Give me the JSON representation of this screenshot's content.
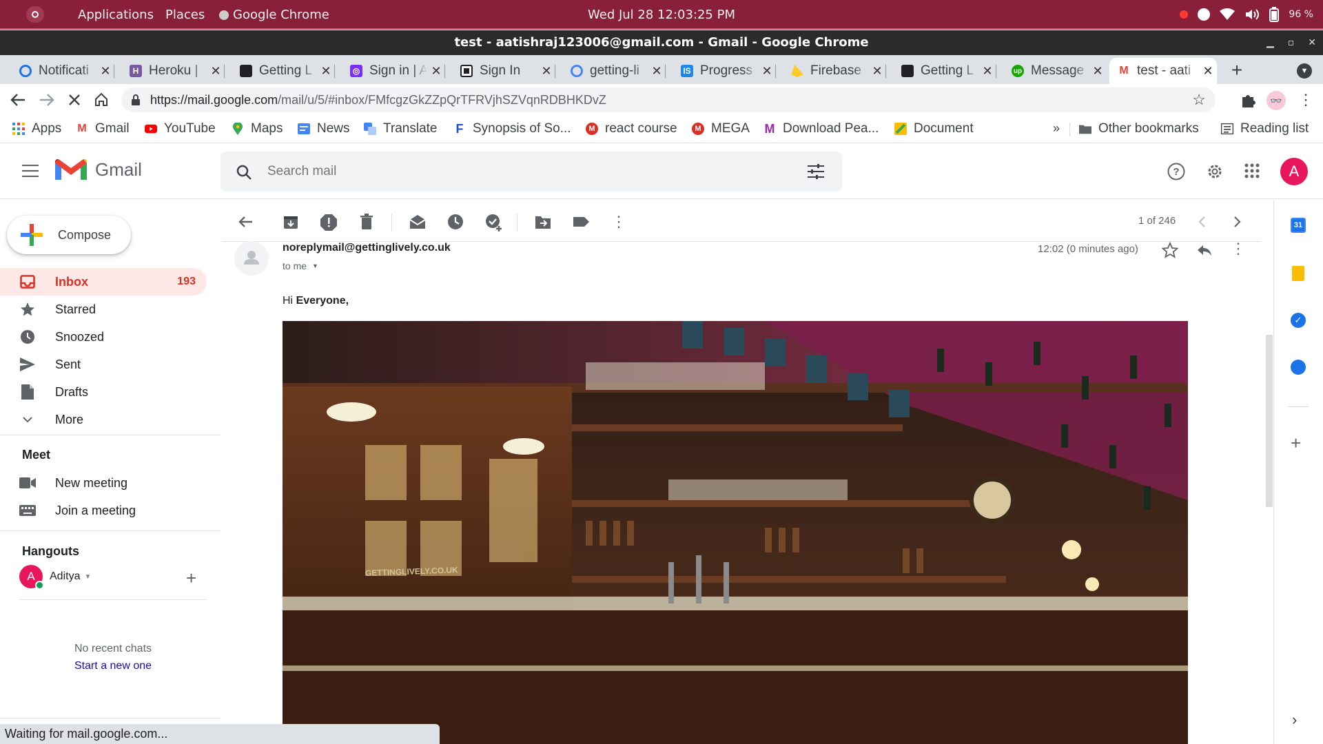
{
  "topbar": {
    "applications": "Applications",
    "places": "Places",
    "app": "Google Chrome",
    "clock": "Wed Jul 28  12:03:25 PM",
    "battery": "96 %"
  },
  "window": {
    "title": "test - aatishraj123006@gmail.com - Gmail - Google Chrome"
  },
  "tabs": [
    {
      "title": "Notificati",
      "color": "#1a73e8"
    },
    {
      "title": "Heroku | ",
      "color": "#79589f"
    },
    {
      "title": "Getting L",
      "color": "#202124"
    },
    {
      "title": "Sign in | A",
      "color": "#7b2ff7"
    },
    {
      "title": "Sign In",
      "color": "#202124"
    },
    {
      "title": "getting-li",
      "color": "#4285f4"
    },
    {
      "title": "Progress",
      "color": "#1e88e5"
    },
    {
      "title": "Firebase ",
      "color": "#ffca28"
    },
    {
      "title": "Getting L",
      "color": "#202124"
    },
    {
      "title": "Message",
      "color": "#14a800"
    },
    {
      "title": "test - aati",
      "color": "#ea4335"
    }
  ],
  "address": {
    "url_host": "https://mail.google.com",
    "url_path": "/mail/u/5/#inbox/FMfcgzGkZZpQrTFRVjhSZVqnRDBHKDvZ"
  },
  "bookmarks": [
    {
      "label": "Apps",
      "color": "#4285f4"
    },
    {
      "label": "Gmail",
      "color": "#ea4335"
    },
    {
      "label": "YouTube",
      "color": "#ff0000"
    },
    {
      "label": "Maps",
      "color": "#34a853"
    },
    {
      "label": "News",
      "color": "#4285f4"
    },
    {
      "label": "Translate",
      "color": "#4285f4"
    },
    {
      "label": "Synopsis of So...",
      "color": "#1a4fd6"
    },
    {
      "label": "react course",
      "color": "#d93025"
    },
    {
      "label": "MEGA",
      "color": "#d93025"
    },
    {
      "label": "Download Pea...",
      "color": "#9c27b0"
    },
    {
      "label": "Document",
      "color": "#fbbc04"
    }
  ],
  "bookmarks_right": {
    "other": "Other bookmarks",
    "reading": "Reading list"
  },
  "gmail": {
    "brand": "Gmail",
    "search_placeholder": "Search mail",
    "avatar_letter": "A"
  },
  "sidebar": {
    "compose": "Compose",
    "nav": [
      {
        "label": "Inbox",
        "count": "193"
      },
      {
        "label": "Starred"
      },
      {
        "label": "Snoozed"
      },
      {
        "label": "Sent"
      },
      {
        "label": "Drafts"
      },
      {
        "label": "More"
      }
    ],
    "meet_heading": "Meet",
    "meet": [
      "New meeting",
      "Join a meeting"
    ],
    "hangouts_heading": "Hangouts",
    "hangouts_user": "Aditya",
    "no_chats": "No recent chats",
    "start_new": "Start a new one"
  },
  "message": {
    "pager": "1 of 246",
    "sender": "noreplymail@gettinglively.co.uk",
    "to": "to me",
    "time": "12:02 (0 minutes ago)",
    "greeting": "Hi ",
    "greeting_name": "Everyone,",
    "image_text": "GETTINGLIVELY.CO.UK"
  },
  "status": "Waiting for mail.google.com...",
  "colors": {
    "ubuntu_bar": "#8a1f3a",
    "gmail_red": "#d93025",
    "avatar": "#e8175d"
  }
}
